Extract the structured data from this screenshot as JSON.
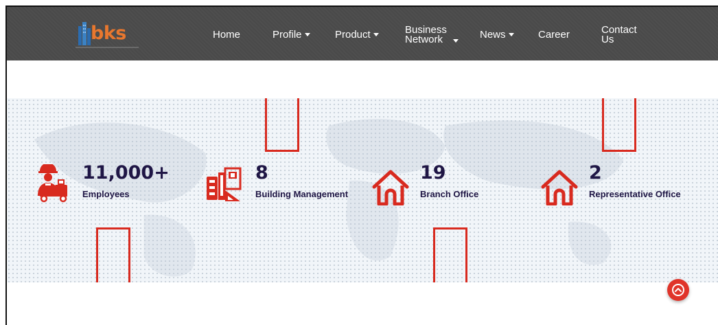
{
  "brand": {
    "name": "bks",
    "logo_color": "#e8772e"
  },
  "nav": {
    "home": "Home",
    "profile": "Profile",
    "product": "Product",
    "business_line1": "Business",
    "business_line2": "Network",
    "news": "News",
    "career": "Career",
    "contact_line1": "Contact",
    "contact_line2": "Us"
  },
  "stats": [
    {
      "value": "11,000+",
      "label": "Employees",
      "icon": "worker-icon"
    },
    {
      "value": "8",
      "label": "Building Management",
      "icon": "blueprint-icon"
    },
    {
      "value": "19",
      "label": "Branch Office",
      "icon": "home-icon"
    },
    {
      "value": "2",
      "label": "Representative Office",
      "icon": "home-icon"
    }
  ],
  "colors": {
    "accent": "#d82a1f",
    "navbar": "#4a4a4a",
    "stat_text": "#1f1645",
    "band": "#f1f5f9"
  },
  "scroll_top_icon": "chevron-up-icon"
}
